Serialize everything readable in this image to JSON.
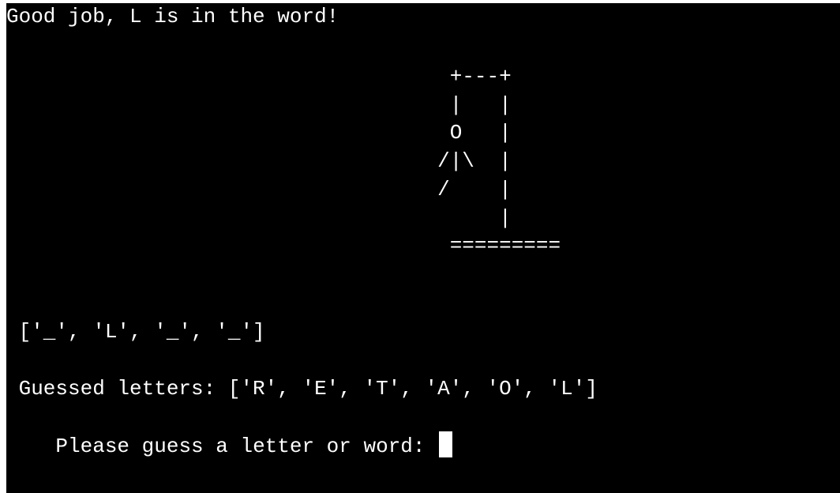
{
  "terminal": {
    "feedback_message": "Good job, L is in the word!",
    "hangman_art": "                                    +---+\n                                    |   |\n                                    O   |\n                                   /|\\  |\n                                   /    |\n                                        |\n                                    =========",
    "word_progress": " ['_', 'L', '_', '_']",
    "guessed_letters": " Guessed letters: ['R', 'E', 'T', 'A', 'O', 'L']",
    "prompt": "Please guess a letter or word: "
  },
  "colors": {
    "background": "#000000",
    "text": "#ffffff",
    "cursor": "#ffffff"
  }
}
